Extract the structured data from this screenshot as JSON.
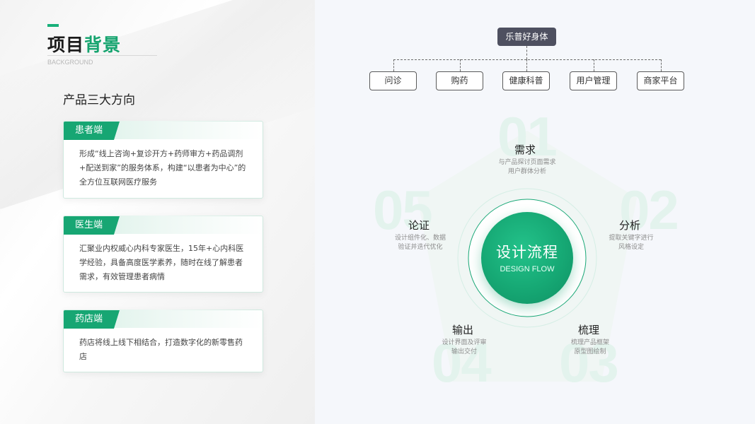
{
  "header": {
    "title_plain": "项目",
    "title_highlight": "背景",
    "subtitle": "BACKGROUND"
  },
  "section": {
    "heading": "产品三大方向"
  },
  "cards": [
    {
      "tag": "患者端",
      "lines": [
        "形成“线上咨询+复诊开方+药师审方+药品调剂",
        "+配送到家”的服务体系，构建“以患者为中心”的",
        "全方位互联网医疗服务"
      ]
    },
    {
      "tag": "医生端",
      "lines": [
        "汇聚业内权威心内科专家医生，15年+心内科医",
        "学经验，具备高度医学素养，随时在线了解患者",
        "需求，有效管理患者病情"
      ]
    },
    {
      "tag": "药店端",
      "lines": [
        "药店将线上线下相结合，打造数字化的新零售药",
        "店"
      ]
    }
  ],
  "tree": {
    "root": "乐普好身体",
    "children": [
      "问诊",
      "购药",
      "健康科普",
      "用户管理",
      "商家平台"
    ]
  },
  "flow": {
    "core_title": "设计流程",
    "core_subtitle": "DESIGN FLOW",
    "steps": [
      {
        "num": "01",
        "title": "需求",
        "desc": [
          "与产品探讨页面需求",
          "用户群体分析"
        ]
      },
      {
        "num": "02",
        "title": "分析",
        "desc": [
          "提取关键字进行",
          "风格设定"
        ]
      },
      {
        "num": "03",
        "title": "梳理",
        "desc": [
          "梳理产品框架",
          "原型图绘制"
        ]
      },
      {
        "num": "04",
        "title": "输出",
        "desc": [
          "设计界面及评审",
          "输出交付"
        ]
      },
      {
        "num": "05",
        "title": "论证",
        "desc": [
          "设计组件化、数据",
          "验证并迭代优化"
        ]
      }
    ]
  },
  "colors": {
    "accent": "#17a673",
    "dark_node": "#4e5060"
  }
}
